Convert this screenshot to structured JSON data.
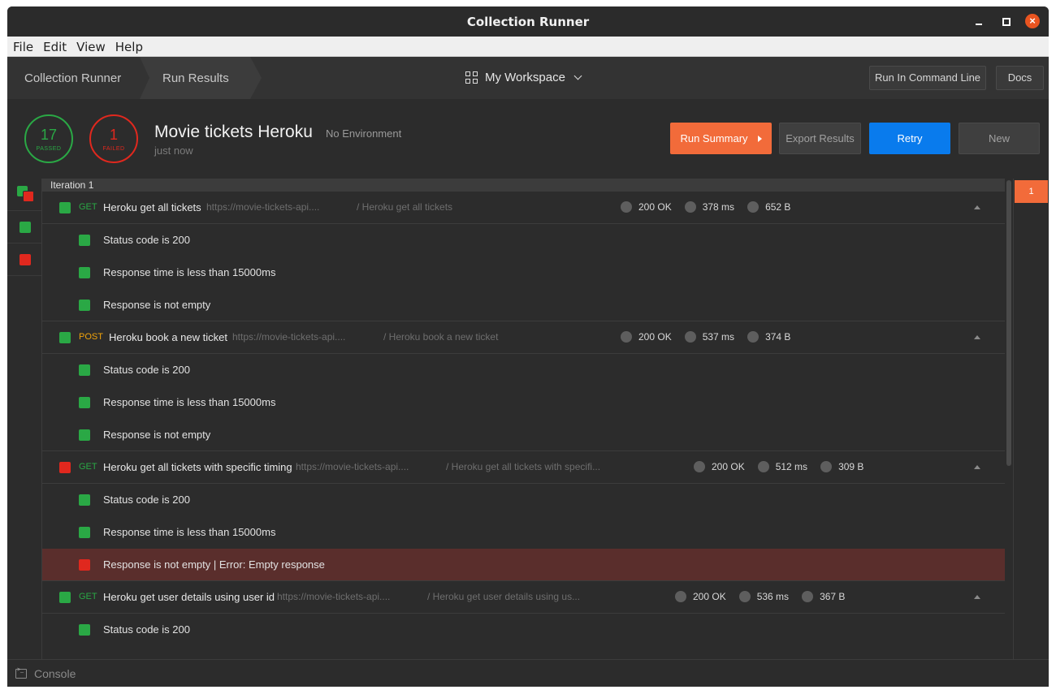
{
  "window": {
    "title": "Collection Runner"
  },
  "menu": [
    "File",
    "Edit",
    "View",
    "Help"
  ],
  "nav": {
    "crumb1": "Collection Runner",
    "crumb2": "Run Results",
    "workspace": "My Workspace",
    "run_cmd": "Run In Command Line",
    "docs": "Docs"
  },
  "summary": {
    "passed_count": "17",
    "passed_label": "PASSED",
    "failed_count": "1",
    "failed_label": "FAILED",
    "collection": "Movie tickets Heroku",
    "environment": "No Environment",
    "when": "just now",
    "btn_summary": "Run Summary",
    "btn_export": "Export Results",
    "btn_retry": "Retry",
    "btn_new": "New"
  },
  "iteration_label": "Iteration 1",
  "iteration_tab": "1",
  "requests": [
    {
      "status": "pass",
      "method": "GET",
      "name": "Heroku get all tickets",
      "url": "https://movie-tickets-api....",
      "path": "/ Heroku get all tickets",
      "code": "200 OK",
      "time": "378 ms",
      "size": "652 B",
      "tests": [
        {
          "status": "pass",
          "name": "Status code is 200"
        },
        {
          "status": "pass",
          "name": "Response time is less than 15000ms"
        },
        {
          "status": "pass",
          "name": "Response is not empty"
        }
      ]
    },
    {
      "status": "pass",
      "method": "POST",
      "name": "Heroku book a new ticket",
      "url": "https://movie-tickets-api....",
      "path": "/ Heroku book a new ticket",
      "code": "200 OK",
      "time": "537 ms",
      "size": "374 B",
      "tests": [
        {
          "status": "pass",
          "name": "Status code is 200"
        },
        {
          "status": "pass",
          "name": "Response time is less than 15000ms"
        },
        {
          "status": "pass",
          "name": "Response is not empty"
        }
      ]
    },
    {
      "status": "fail",
      "method": "GET",
      "name": "Heroku get all tickets with specific timing",
      "url": "https://movie-tickets-api....",
      "path": "/ Heroku get all tickets with specifi...",
      "code": "200 OK",
      "time": "512 ms",
      "size": "309 B",
      "tests": [
        {
          "status": "pass",
          "name": "Status code is 200"
        },
        {
          "status": "pass",
          "name": "Response time is less than 15000ms"
        },
        {
          "status": "fail",
          "name": "Response is not empty | Error: Empty response"
        }
      ]
    },
    {
      "status": "pass",
      "method": "GET",
      "name": "Heroku get user details using user id",
      "url": "https://movie-tickets-api....",
      "path": "/ Heroku get user details using us...",
      "code": "200 OK",
      "time": "536 ms",
      "size": "367 B",
      "tests": [
        {
          "status": "pass",
          "name": "Status code is 200"
        }
      ]
    }
  ],
  "console": "Console",
  "colors": {
    "pass": "#2aa845",
    "fail": "#e0281e",
    "accent": "#f26b3a",
    "primary": "#097bed"
  }
}
